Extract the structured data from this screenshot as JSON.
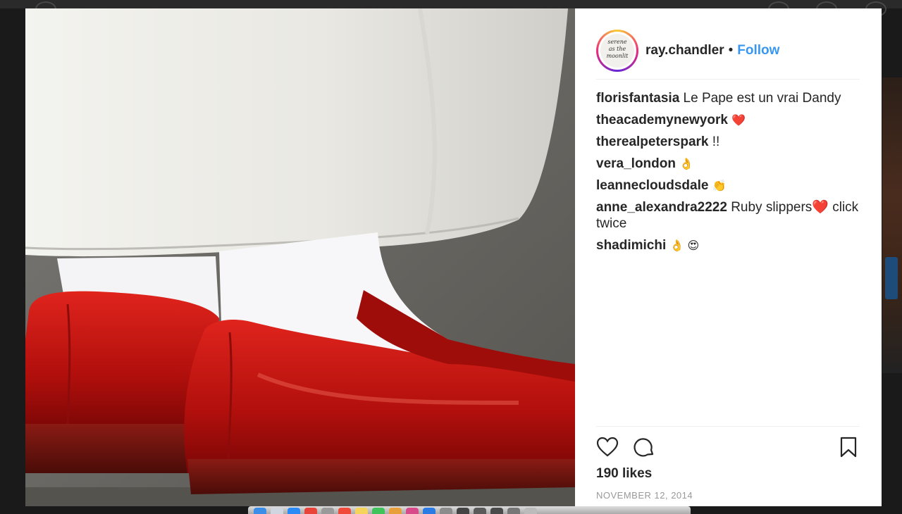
{
  "post": {
    "username": "ray.chandler",
    "separator": "•",
    "follow_label": "Follow",
    "likes": "190 likes",
    "date": "NOVEMBER 12, 2014"
  },
  "comments": [
    {
      "user": "florisfantasia",
      "text": "Le Pape est un vrai Dandy"
    },
    {
      "user": "theacademynewyork",
      "text": "❤️"
    },
    {
      "user": "therealpeterspark",
      "text": "!!"
    },
    {
      "user": "vera_london",
      "text": "👌"
    },
    {
      "user": "leannecloudsdale",
      "text": "👏"
    },
    {
      "user": "anne_alexandra2222",
      "text": "Ruby slippers❤️  click twice"
    },
    {
      "user": "shadimichi",
      "text": "👌 😍"
    }
  ],
  "icons": {
    "like": "heart-icon",
    "comment": "comment-bubble-icon",
    "save": "bookmark-icon"
  },
  "colors": {
    "follow": "#3897f0",
    "text": "#262626",
    "muted": "#999999",
    "shoe_red": "#c0120f"
  }
}
